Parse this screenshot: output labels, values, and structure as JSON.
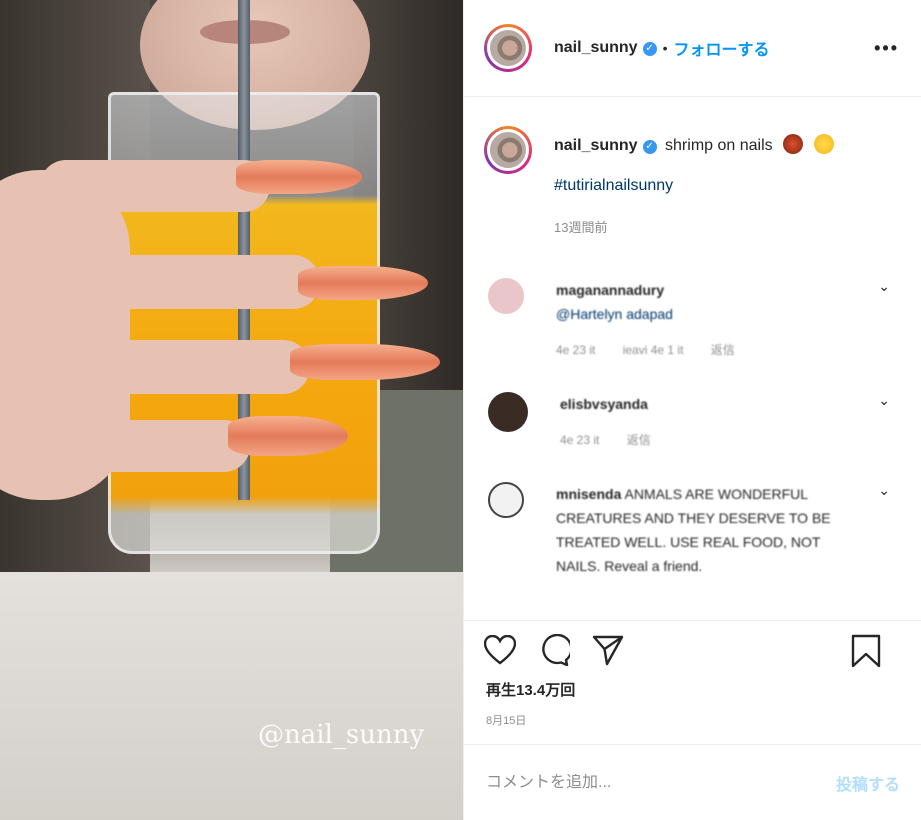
{
  "media": {
    "watermark": "@nail_sunny"
  },
  "header": {
    "username": "nail_sunny",
    "verified_icon": "verified-badge-icon",
    "separator": "•",
    "follow_label": "フォローする",
    "more_icon": "more-options-icon",
    "more_text": "•••"
  },
  "caption": {
    "username": "nail_sunny",
    "text": "shrimp on nails",
    "emojis": [
      "shrimp-emoji",
      "laughing-emoji"
    ],
    "hashtag": "#tutirialnailsunny",
    "time": "13週間前"
  },
  "comments": [
    {
      "username": "maganannadury",
      "text": "@Hartelyn adapad",
      "meta": [
        "4e 23 it",
        "ieavi 4e 1 it",
        "返信"
      ],
      "avatar_color": "#e9c6c9"
    },
    {
      "username": "elisbvsyanda",
      "text": "",
      "meta": [
        "4e 23 it",
        "返信"
      ],
      "avatar_color": "#3a2c25"
    },
    {
      "username": "mnisenda",
      "text": "ANMALS ARE WONDERFUL CREATURES AND THEY DESERVE TO BE TREATED WELL. USE REAL FOOD, NOT NAILS. Reveal a friend.",
      "meta": [],
      "avatar_color": "#f2f2f2"
    }
  ],
  "actions": {
    "like_icon": "heart-icon",
    "comment_icon": "comment-icon",
    "share_icon": "share-icon",
    "save_icon": "bookmark-icon",
    "views": "再生13.4万回",
    "date": "8月15日"
  },
  "comment_box": {
    "placeholder": "コメントを追加...",
    "post_label": "投稿する"
  },
  "colors": {
    "accent": "#0095f6",
    "link": "#00376b",
    "muted": "#8e8e8e",
    "post_disabled": "#b2dffc"
  }
}
